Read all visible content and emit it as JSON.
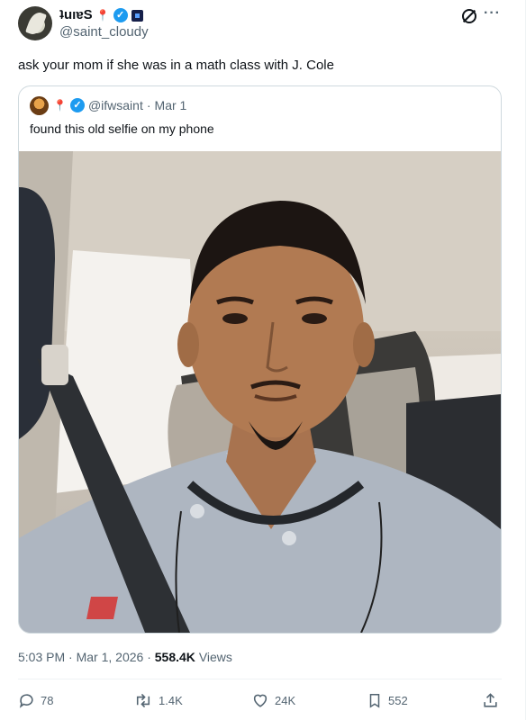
{
  "header": {
    "display_name": "ʇuıɐS",
    "pin_emoji": "📍",
    "verified_mark": "✓",
    "handle": "@saint_cloudy",
    "more_label": "···"
  },
  "tweet": {
    "text": "ask your mom if she was in a math class with J. Cole"
  },
  "quote": {
    "pin_emoji": "📍",
    "verified_mark": "✓",
    "handle": "@ifwsaint",
    "separator": "·",
    "date": "Mar 1",
    "text": "found this old selfie on my phone"
  },
  "meta": {
    "time": "5:03 PM",
    "sep1": "·",
    "date": "Mar 1, 2026",
    "sep2": "·",
    "views_count": "558.4K",
    "views_label": "Views"
  },
  "actions": {
    "replies": "78",
    "reposts": "1.4K",
    "likes": "24K",
    "bookmarks": "552"
  },
  "icons": {
    "more": "more-icon",
    "grok": "grok-icon",
    "reply": "reply-icon",
    "repost": "repost-icon",
    "like": "heart-icon",
    "bookmark": "bookmark-icon",
    "share": "share-icon"
  },
  "colors": {
    "verified": "#1d9bf0",
    "secondary_text": "#536471",
    "primary_text": "#0f1419",
    "border": "#cfd9de"
  }
}
